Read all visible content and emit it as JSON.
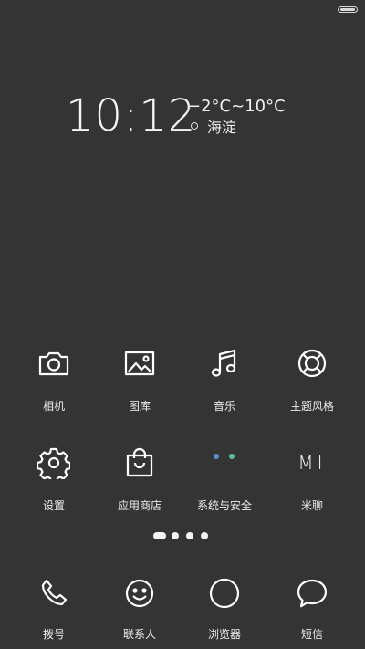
{
  "status_bar": {
    "battery_icon": "battery-icon"
  },
  "clock_widget": {
    "time": "10:12",
    "temperature_range": "−2°C~10°C",
    "location": "海淀"
  },
  "home_apps": [
    {
      "label": "相机",
      "icon": "camera-icon"
    },
    {
      "label": "图库",
      "icon": "gallery-icon"
    },
    {
      "label": "音乐",
      "icon": "music-icon"
    },
    {
      "label": "主题风格",
      "icon": "theme-icon"
    },
    {
      "label": "设置",
      "icon": "gear-icon"
    },
    {
      "label": "应用商店",
      "icon": "shopping-bag-icon"
    },
    {
      "label": "系统与安全",
      "icon": "security-folder-icon"
    },
    {
      "label": "米聊",
      "icon": "mi-chat-icon",
      "icon_text": "MI"
    }
  ],
  "page_indicator": {
    "pages": 4,
    "current": 1
  },
  "dock": [
    {
      "label": "拨号",
      "icon": "phone-icon"
    },
    {
      "label": "联系人",
      "icon": "smiley-icon"
    },
    {
      "label": "浏览器",
      "icon": "browser-circle-icon"
    },
    {
      "label": "短信",
      "icon": "message-bubble-icon"
    }
  ]
}
